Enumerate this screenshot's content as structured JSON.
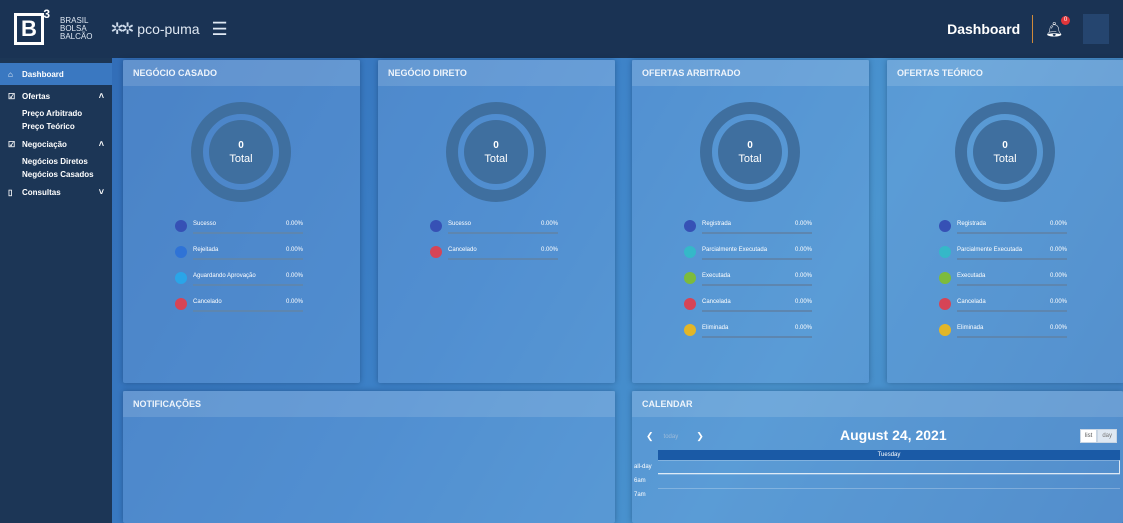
{
  "header": {
    "brand_lines": [
      "BRASIL",
      "BOLSA",
      "BALCÃO"
    ],
    "brand_mark": "B",
    "brand_sup": "3",
    "app_name": "pco-puma",
    "title": "Dashboard",
    "notification_count": "0",
    "icons": {
      "menu": "hamburger-icon",
      "notifications": "bell-icon"
    }
  },
  "sidebar": {
    "dashboard": "Dashboard",
    "ofertas": "Ofertas",
    "preco_arbitrado": "Preço Arbitrado",
    "preco_teorico": "Preço Teórico",
    "negociacao": "Negociação",
    "negocios_diretos": "Negócios Diretos",
    "negocios_casados": "Negócios Casados",
    "consultas": "Consultas"
  },
  "cards": [
    {
      "title": "NEGÓCIO CASADO",
      "total_value": "0",
      "total_label": "Total",
      "legend": [
        {
          "label": "Sucesso",
          "value": "0.00%",
          "color": "#3651b5"
        },
        {
          "label": "Rejeitada",
          "value": "0.00%",
          "color": "#2f73d6"
        },
        {
          "label": "Aguardando Aprovação",
          "value": "0.00%",
          "color": "#2aa5e8"
        },
        {
          "label": "Cancelado",
          "value": "0.00%",
          "color": "#d64456"
        }
      ]
    },
    {
      "title": "NEGÓCIO DIRETO",
      "total_value": "0",
      "total_label": "Total",
      "legend": [
        {
          "label": "Sucesso",
          "value": "0.00%",
          "color": "#3651b5"
        },
        {
          "label": "Cancelado",
          "value": "0.00%",
          "color": "#d64456"
        }
      ]
    },
    {
      "title": "OFERTAS ARBITRADO",
      "total_value": "0",
      "total_label": "Total",
      "legend": [
        {
          "label": "Registrada",
          "value": "0.00%",
          "color": "#3651b5"
        },
        {
          "label": "Parcialmente Executada",
          "value": "0.00%",
          "color": "#35b8c8"
        },
        {
          "label": "Executada",
          "value": "0.00%",
          "color": "#7dbb3c"
        },
        {
          "label": "Cancelada",
          "value": "0.00%",
          "color": "#d64456"
        },
        {
          "label": "Eliminada",
          "value": "0.00%",
          "color": "#e3b627"
        }
      ]
    },
    {
      "title": "OFERTAS TEÓRICO",
      "total_value": "0",
      "total_label": "Total",
      "legend": [
        {
          "label": "Registrada",
          "value": "0.00%",
          "color": "#3651b5"
        },
        {
          "label": "Parcialmente Executada",
          "value": "0.00%",
          "color": "#35b8c8"
        },
        {
          "label": "Executada",
          "value": "0.00%",
          "color": "#7dbb3c"
        },
        {
          "label": "Cancelada",
          "value": "0.00%",
          "color": "#d64456"
        },
        {
          "label": "Eliminada",
          "value": "0.00%",
          "color": "#e3b627"
        }
      ]
    }
  ],
  "notifications": {
    "title": "NOTIFICAÇÕES"
  },
  "calendar": {
    "title": "CALENDAR",
    "today_label": "today",
    "date": "August 24, 2021",
    "view_list": "list",
    "view_day": "day",
    "weekday": "Tuesday",
    "rows": [
      "all-day",
      "6am",
      "7am"
    ]
  }
}
